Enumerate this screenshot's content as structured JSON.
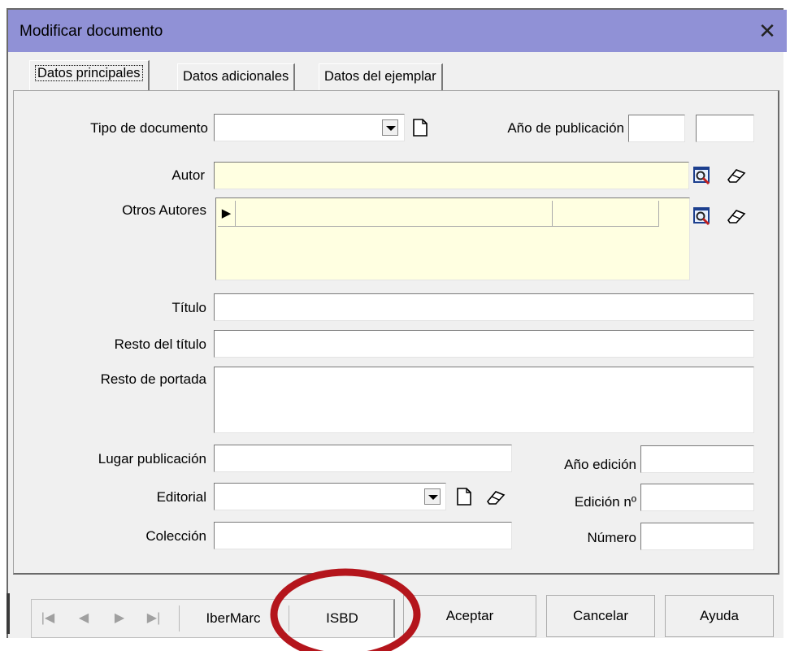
{
  "window": {
    "title": "Modificar documento",
    "close_glyph": "✕"
  },
  "tabs": [
    {
      "label": "Datos principales",
      "active": true
    },
    {
      "label": "Datos adicionales",
      "active": false
    },
    {
      "label": "Datos del ejemplar",
      "active": false
    }
  ],
  "form": {
    "tipo_documento": {
      "label": "Tipo de documento",
      "value": ""
    },
    "anio_publicacion": {
      "label": "Año de publicación",
      "value_1": "",
      "value_2": ""
    },
    "autor": {
      "label": "Autor",
      "value": ""
    },
    "otros_autores": {
      "label": "Otros Autores",
      "row_indicator": "▶"
    },
    "titulo": {
      "label": "Título",
      "value": ""
    },
    "resto_titulo": {
      "label": "Resto del título",
      "value": ""
    },
    "resto_portada": {
      "label": "Resto de portada",
      "value": ""
    },
    "lugar_publicacion": {
      "label": "Lugar publicación",
      "value": ""
    },
    "anio_edicion": {
      "label": "Año edición",
      "value": ""
    },
    "editorial": {
      "label": "Editorial",
      "value": ""
    },
    "edicion_no": {
      "label": "Edición nº",
      "value": ""
    },
    "coleccion": {
      "label": "Colección",
      "value": ""
    },
    "numero": {
      "label": "Número",
      "value": ""
    }
  },
  "footer": {
    "nav": {
      "first": "|◀",
      "prev": "◀",
      "next": "▶",
      "last": "▶|"
    },
    "ibermarc_label": "IberMarc",
    "isbd_label": "ISBD",
    "aceptar_label": "Aceptar",
    "cancelar_label": "Cancelar",
    "ayuda_label": "Ayuda"
  },
  "colors": {
    "titlebar": "#9091d6",
    "field_yellow": "#ffffe1",
    "annotation_circle": "#b4151c"
  },
  "icons": [
    "dropdown-arrow-icon",
    "new-document-icon",
    "search-icon",
    "eraser-icon",
    "close-icon"
  ]
}
